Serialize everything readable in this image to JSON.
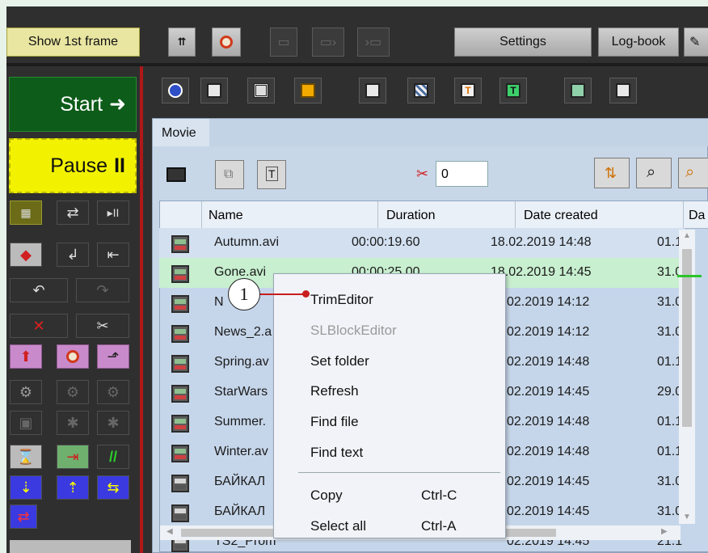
{
  "toolbar": {
    "show_first_frame": "Show 1st frame",
    "settings": "Settings",
    "logbook": "Log-book"
  },
  "left_panel": {
    "start": "Start",
    "pause": "Pause"
  },
  "files_panel": {
    "tab_label": "Movie",
    "counter_value": "0",
    "columns": [
      "Name",
      "Duration",
      "Date created",
      "Da"
    ],
    "rows": [
      {
        "name": "Autumn.avi",
        "duration": "00:00:19.60",
        "created": "18.02.2019 14:48",
        "extra": "01.1"
      },
      {
        "name": "Gone.avi",
        "duration": "00:00:25.00",
        "created": "18.02.2019 14:45",
        "extra": "31.0"
      },
      {
        "name": "N",
        "duration": "",
        "created": "02.2019 14:12",
        "extra": "31.0"
      },
      {
        "name": "News_2.a",
        "duration": "",
        "created": "02.2019 14:12",
        "extra": "31.0"
      },
      {
        "name": "Spring.av",
        "duration": "",
        "created": "02.2019 14:48",
        "extra": "01.1"
      },
      {
        "name": "StarWars",
        "duration": "",
        "created": "02.2019 14:45",
        "extra": "29.0"
      },
      {
        "name": "Summer.",
        "duration": "",
        "created": "02.2019 14:48",
        "extra": "01.1"
      },
      {
        "name": "Winter.av",
        "duration": "",
        "created": "02.2019 14:48",
        "extra": "01.1"
      },
      {
        "name": "БАЙКАЛ",
        "duration": "",
        "created": "02.2019 14:45",
        "extra": "31.0"
      },
      {
        "name": "БАЙКАЛ",
        "duration": "",
        "created": "02.2019 14:45",
        "extra": "31.0"
      },
      {
        "name": "TS2_Prom",
        "duration": "",
        "created": "02.2019 14:45",
        "extra": "21.1"
      }
    ]
  },
  "context_menu": {
    "items": [
      {
        "label": "TrimEditor",
        "shortcut": "",
        "disabled": false
      },
      {
        "label": "SLBlockEditor",
        "shortcut": "",
        "disabled": true
      },
      {
        "label": "Set folder",
        "shortcut": "",
        "disabled": false
      },
      {
        "label": "Refresh",
        "shortcut": "",
        "disabled": false
      },
      {
        "label": "Find file",
        "shortcut": "",
        "disabled": false
      },
      {
        "label": "Find text",
        "shortcut": "",
        "disabled": false
      },
      {
        "label": "Copy",
        "shortcut": "Ctrl-C",
        "disabled": false
      },
      {
        "label": "Select all",
        "shortcut": "Ctrl-A",
        "disabled": false
      }
    ]
  },
  "callout": {
    "number": "1"
  },
  "colors": {
    "start_bg": "#0d5c19",
    "pause_bg": "#f2f200",
    "selected_row": "#c8efcf",
    "panel_bg": "#c8d7e8",
    "callout_red": "#c81e1e"
  }
}
